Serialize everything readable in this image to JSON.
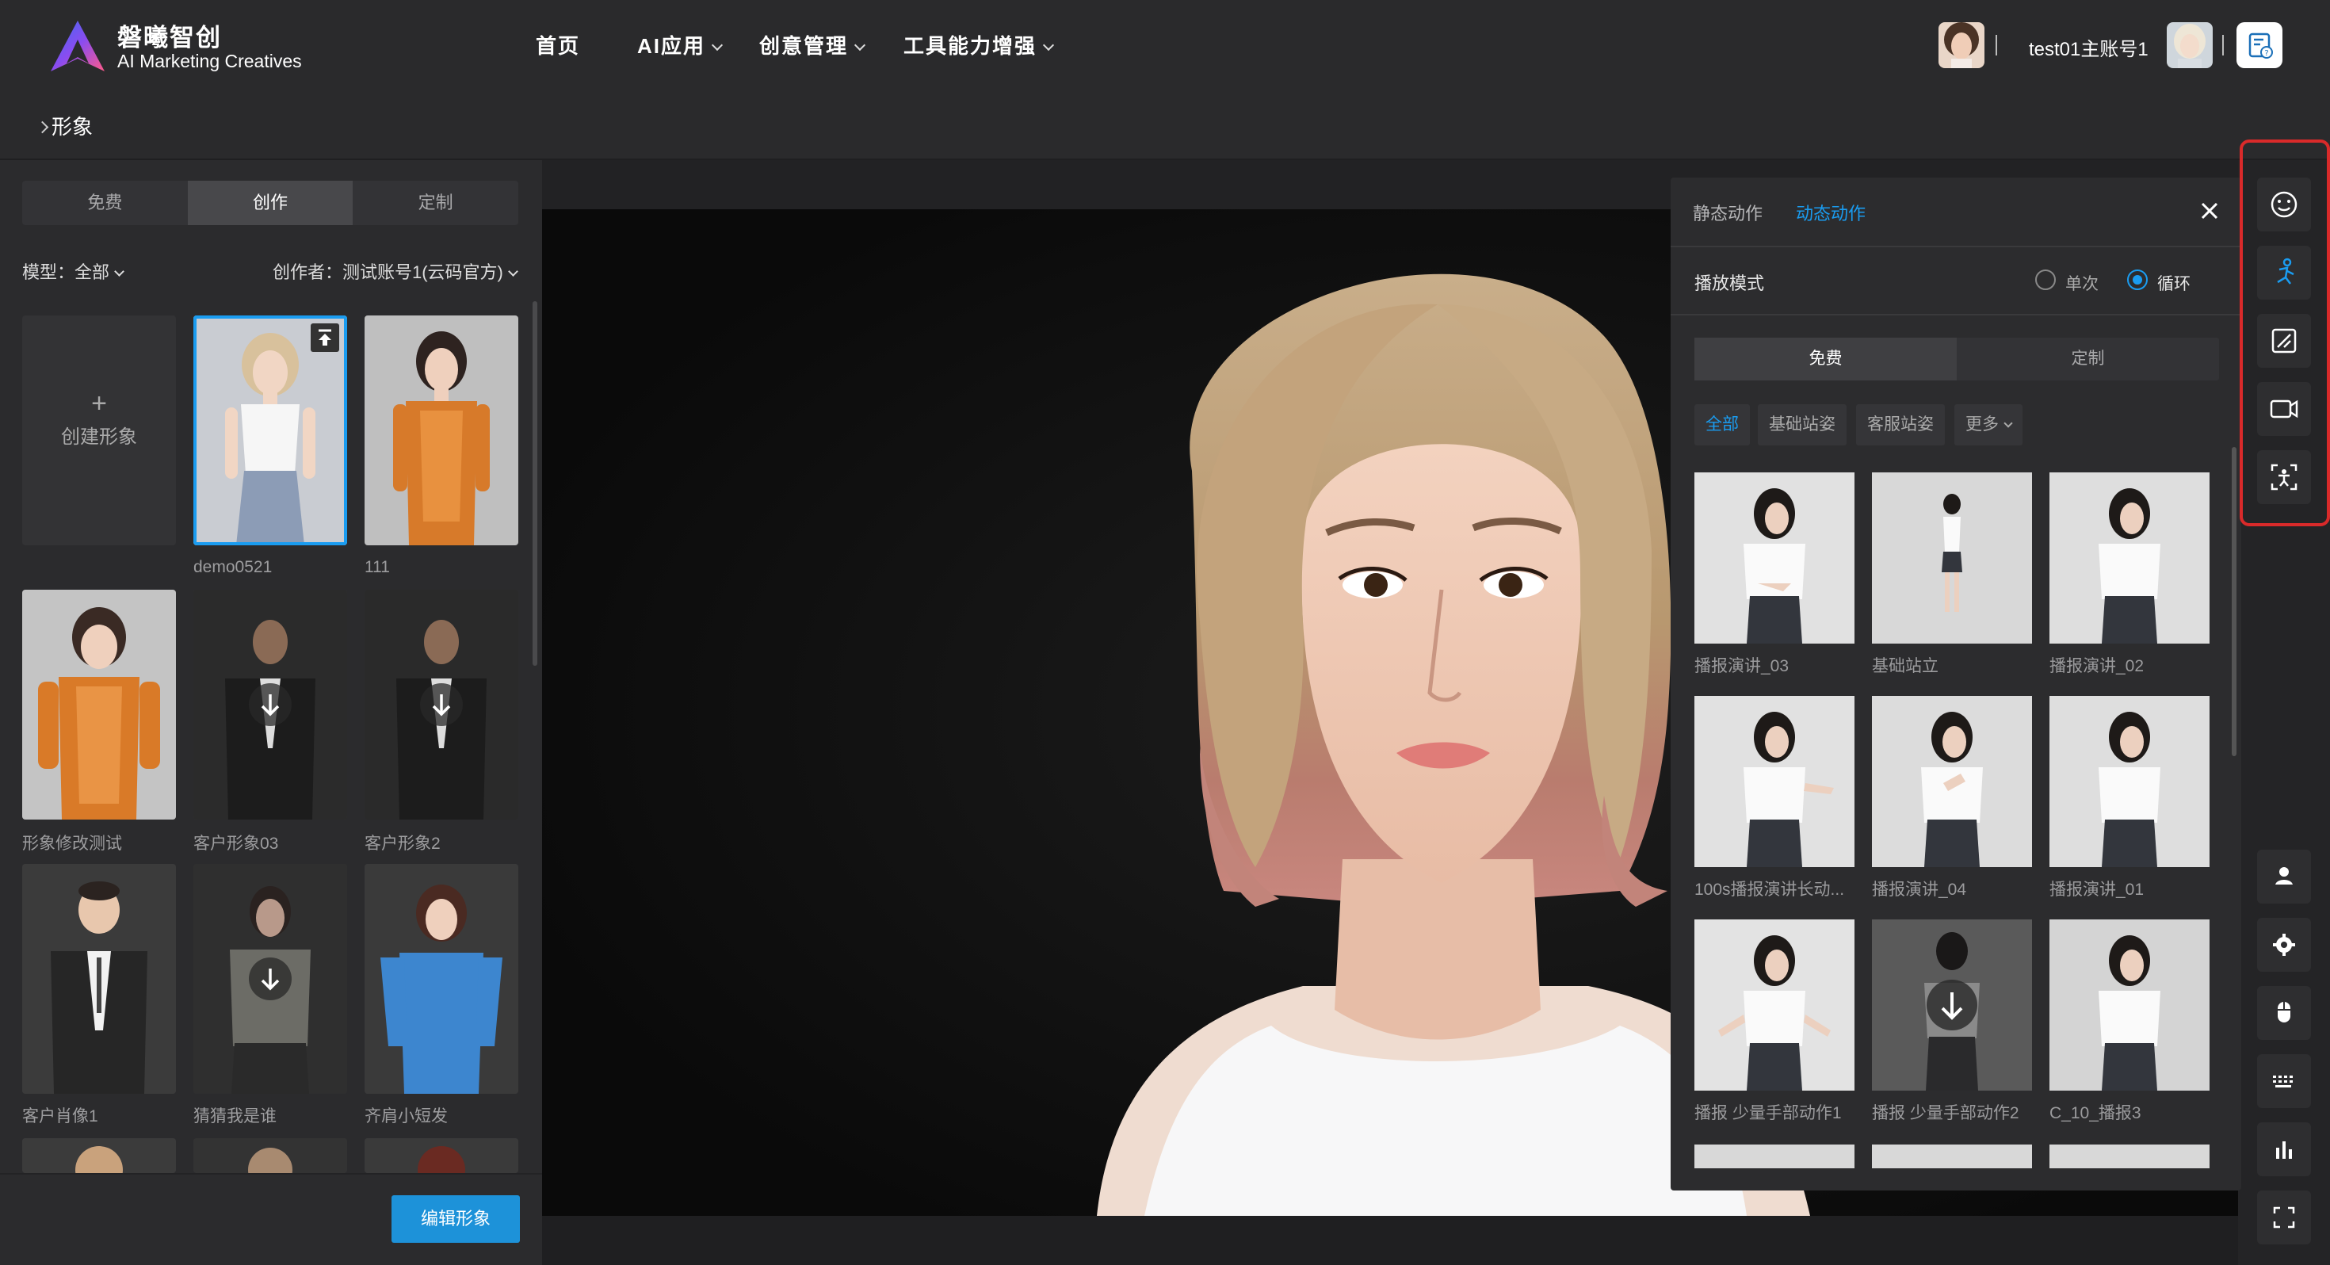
{
  "brand": {
    "name_cn": "磐曦智创",
    "name_en": "AI Marketing Creatives"
  },
  "nav": [
    {
      "label": "首页"
    },
    {
      "label": "AI应用"
    },
    {
      "label": "创意管理"
    },
    {
      "label": "工具能力增强"
    }
  ],
  "header": {
    "account_name": "test01主账号1",
    "help_icon": "help-doc-icon"
  },
  "breadcrumb": {
    "current": "形象"
  },
  "left_panel": {
    "tabs": [
      "免费",
      "创作",
      "定制"
    ],
    "active_tab": "创作",
    "model_filter": "模型：全部",
    "creator_filter": "创作者：测试账号1(云码官方)",
    "create_label": "创建形象",
    "create_plus": "+",
    "avatars": [
      {
        "label": "demo0521",
        "selected": true,
        "badge": "upload"
      },
      {
        "label": "111",
        "selected": false,
        "badge": ""
      },
      {
        "label": "形象修改测试",
        "selected": false,
        "badge": ""
      },
      {
        "label": "客户形象03",
        "selected": false,
        "badge": "download"
      },
      {
        "label": "客户形象2",
        "selected": false,
        "badge": "download"
      },
      {
        "label": "客户肖像1",
        "selected": false,
        "badge": ""
      },
      {
        "label": "猜猜我是谁",
        "selected": false,
        "badge": "download"
      },
      {
        "label": "齐肩小短发",
        "selected": false,
        "badge": ""
      }
    ],
    "edit_button": "编辑形象"
  },
  "action_panel": {
    "tabs": [
      "静态动作",
      "动态动作"
    ],
    "active_tab": "动态动作",
    "play_mode_label": "播放模式",
    "play_modes": [
      "单次",
      "循环"
    ],
    "play_mode_selected": "循环",
    "sub_tabs": [
      "免费",
      "定制"
    ],
    "active_sub_tab": "免费",
    "categories": [
      "全部",
      "基础站姿",
      "客服站姿",
      "更多"
    ],
    "active_category": "全部",
    "actions": [
      {
        "label": "播报演讲_03"
      },
      {
        "label": "基础站立"
      },
      {
        "label": "播报演讲_02"
      },
      {
        "label": "100s播报演讲长动..."
      },
      {
        "label": "播报演讲_04"
      },
      {
        "label": "播报演讲_01"
      },
      {
        "label": "播报 少量手部动作1"
      },
      {
        "label": "播报 少量手部动作2"
      },
      {
        "label": "C_10_播报3"
      }
    ]
  },
  "right_toolbar": {
    "top_tools": [
      "expression-icon",
      "motion-icon",
      "background-icon",
      "camera-icon",
      "motion-capture-icon"
    ],
    "bottom_tools": [
      "person-icon",
      "settings-icon",
      "mouse-icon",
      "keyboard-icon",
      "stats-icon",
      "fullscreen-icon"
    ]
  },
  "colors": {
    "accent": "#1a9cf0",
    "highlight_border": "#d92a2a",
    "primary_button": "#1d92d9"
  }
}
